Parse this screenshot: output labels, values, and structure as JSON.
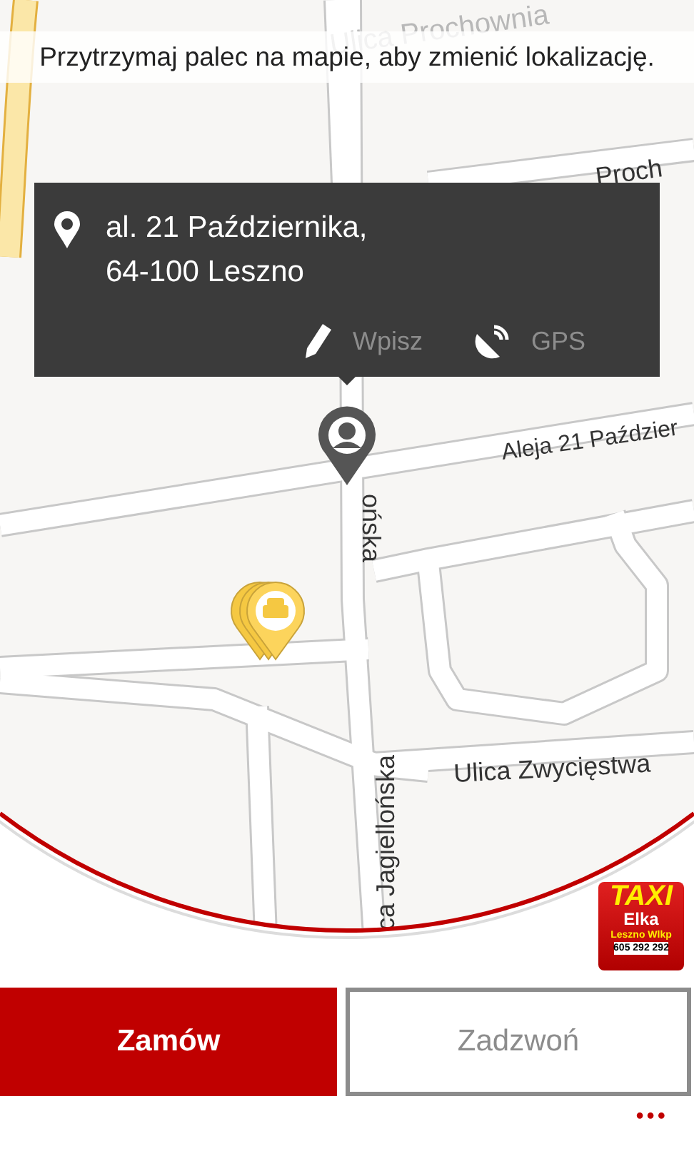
{
  "hint": "Przytrzymaj palec na mapie, aby zmienić lokalizację.",
  "map": {
    "labels": [
      {
        "kind": "faded",
        "text": "Ulica Prochownia"
      },
      {
        "kind": "normal",
        "text": "Proch"
      },
      {
        "kind": "down",
        "text": "ońska"
      },
      {
        "kind": "normal",
        "text": "Aleja 21 Paździer"
      },
      {
        "kind": "normal",
        "text": "Ulica Zwycięstwa"
      },
      {
        "kind": "up",
        "text": "ca Jagiellońska"
      }
    ]
  },
  "popup": {
    "address": [
      "al. 21 Października,",
      "64-100 Leszno"
    ],
    "actions": [
      {
        "kind": "type",
        "label": "Wpisz"
      },
      {
        "kind": "gps",
        "label": "GPS"
      }
    ]
  },
  "logo": {
    "title": "TAXI",
    "name": "Elka",
    "city": "Leszno Wlkp",
    "phone": "605 292 292"
  },
  "buttons": [
    {
      "label": "Zamów",
      "primary": true
    },
    {
      "label": "Zadzwoń",
      "primary": false
    }
  ],
  "more": "•••"
}
